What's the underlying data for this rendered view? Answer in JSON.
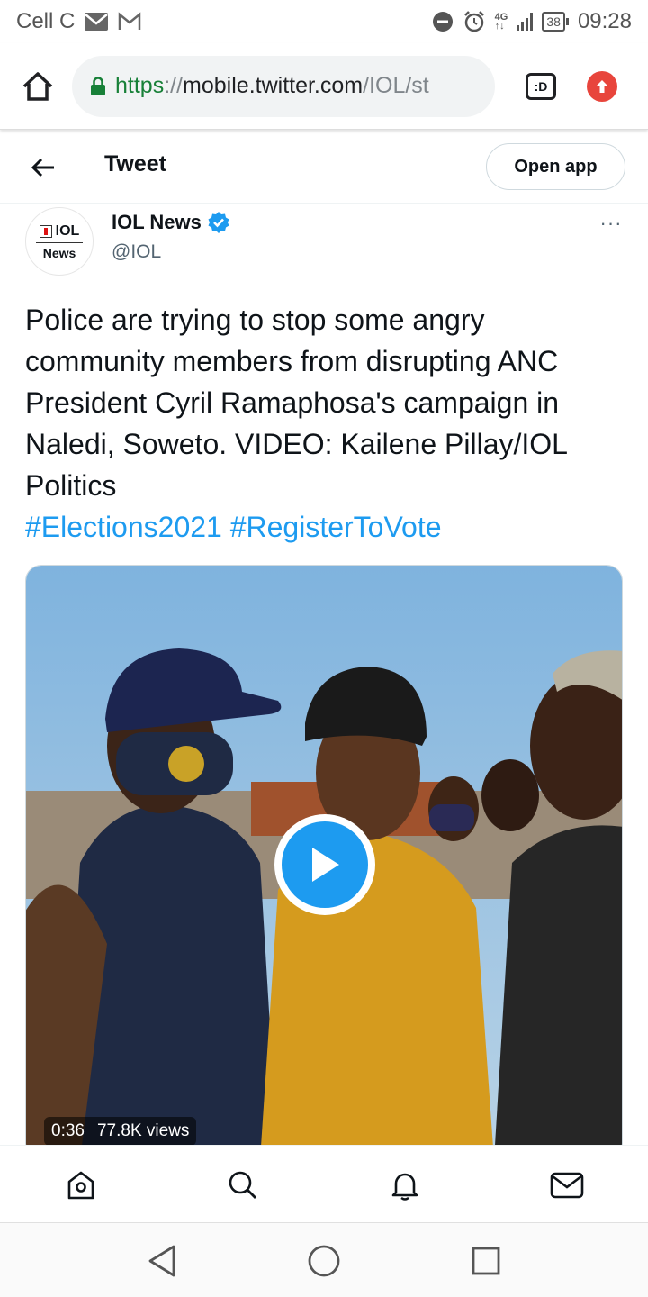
{
  "status_bar": {
    "carrier": "Cell C",
    "network": "4G",
    "battery": "38",
    "time": "09:28",
    "icons": [
      "mail-icon",
      "gmail-icon",
      "dnd-icon",
      "alarm-icon",
      "signal-icon",
      "battery-icon"
    ]
  },
  "browser": {
    "url_scheme": "https",
    "url_sep": "://",
    "url_host": "mobile.twitter.com",
    "url_path": "/IOL/st",
    "tabs_label": ":D"
  },
  "header": {
    "title": "Tweet",
    "open_app_label": "Open app"
  },
  "tweet": {
    "avatar_top": "IOL",
    "avatar_bottom": "News",
    "author_name": "IOL News",
    "author_handle": "@IOL",
    "more_label": "···",
    "text": "Police are trying to stop some angry community members from disrupting ANC President Cyril Ramaphosa's campaign in Naledi, Soweto. VIDEO: Kailene Pillay/IOL Politics",
    "hashtags": [
      "#Elections2021",
      "#RegisterToVote"
    ],
    "video": {
      "duration": "0:36",
      "views": "77.8K views"
    }
  },
  "colors": {
    "twitter_blue": "#1d9bf0",
    "secure_green": "#188038",
    "update_red": "#e8453c"
  }
}
